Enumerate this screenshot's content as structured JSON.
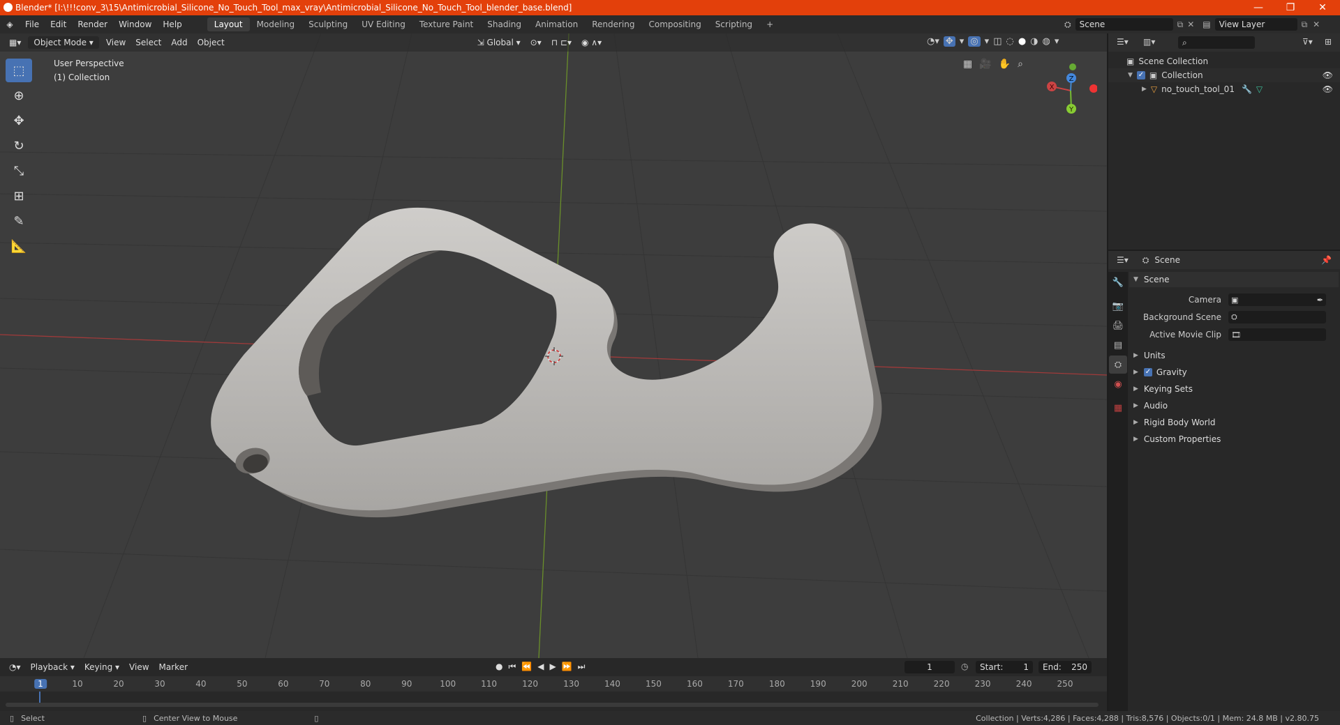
{
  "window": {
    "title": "Blender* [I:\\!!!conv_3\\15\\Antimicrobial_Silicone_No_Touch_Tool_max_vray\\Antimicrobial_Silicone_No_Touch_Tool_blender_base.blend]",
    "minimize": "—",
    "maximize": "❐",
    "close": "✕"
  },
  "menus": [
    "File",
    "Edit",
    "Render",
    "Window",
    "Help"
  ],
  "workspaces": [
    "Layout",
    "Modeling",
    "Sculpting",
    "UV Editing",
    "Texture Paint",
    "Shading",
    "Animation",
    "Rendering",
    "Compositing",
    "Scripting"
  ],
  "add_workspace": "+",
  "scene_selector": "Scene",
  "view_layer": "View Layer",
  "viewport": {
    "mode": "Object Mode",
    "menus": [
      "View",
      "Select",
      "Add",
      "Object"
    ],
    "transform_orientation": "Global",
    "overlay_title": "User Perspective",
    "overlay_collection": "(1) Collection",
    "gizmo": {
      "x": "X",
      "y": "Y",
      "z": "Z"
    },
    "colors": {
      "bg": "#3d3d3d",
      "x_axis": "#a03a3a",
      "y_axis": "#6a8f2a",
      "model": "#bdbbb8"
    }
  },
  "tools": [
    "select-box",
    "cursor",
    "move",
    "rotate",
    "scale",
    "transform",
    "annotate",
    "measure"
  ],
  "timeline": {
    "menus": [
      "Playback",
      "Keying",
      "View",
      "Marker"
    ],
    "current_frame": "1",
    "start_label": "Start:",
    "start": "1",
    "end_label": "End:",
    "end": "250",
    "ticks": [
      "1",
      "10",
      "20",
      "30",
      "40",
      "50",
      "60",
      "70",
      "80",
      "90",
      "100",
      "110",
      "120",
      "130",
      "140",
      "150",
      "160",
      "170",
      "180",
      "190",
      "200",
      "210",
      "220",
      "230",
      "240",
      "250"
    ]
  },
  "status": {
    "left1": "Select",
    "left2": "Center View to Mouse",
    "right": "Collection | Verts:4,286 | Faces:4,288 | Tris:8,576 | Objects:0/1 | Mem: 24.8 MB | v2.80.75"
  },
  "outliner": {
    "root": "Scene Collection",
    "collection": "Collection",
    "object": "no_touch_tool_01"
  },
  "properties": {
    "header": "Scene",
    "section": "Scene",
    "camera_label": "Camera",
    "background_label": "Background Scene",
    "movieclip_label": "Active Movie Clip",
    "panels": [
      "Units",
      "Gravity",
      "Keying Sets",
      "Audio",
      "Rigid Body World",
      "Custom Properties"
    ]
  }
}
